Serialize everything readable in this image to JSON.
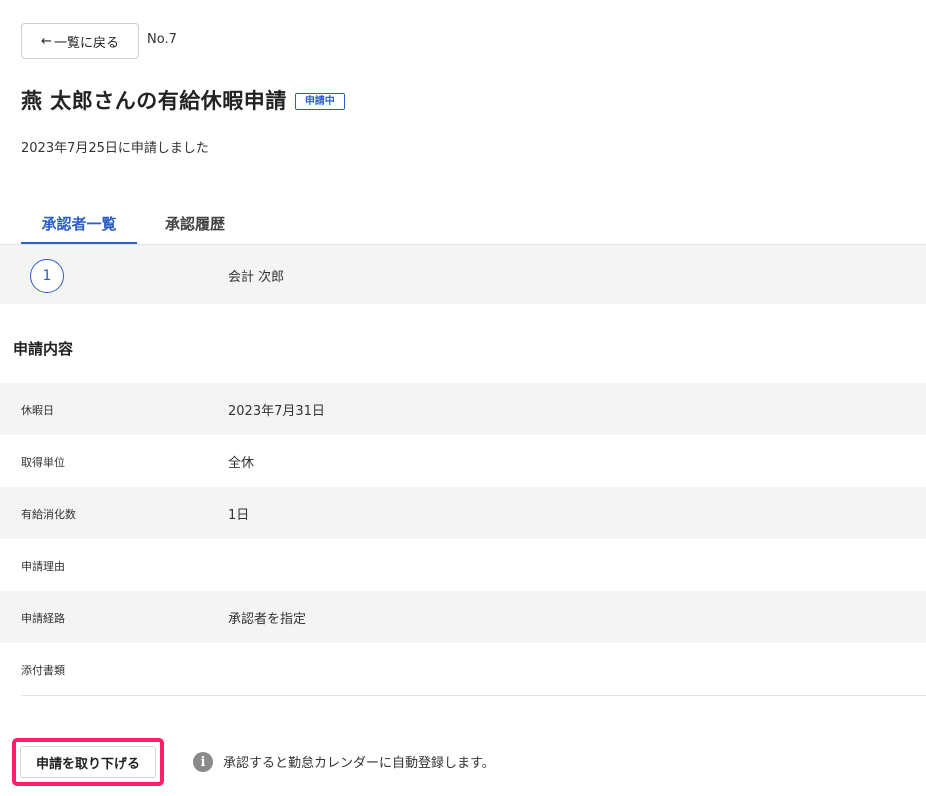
{
  "header": {
    "back_arrow": "←",
    "back_label": "一覧に戻る",
    "record_no": "No.7"
  },
  "title": {
    "text": "燕 太郎さんの有給休暇申請",
    "status": "申請中"
  },
  "applied_date": "2023年7月25日に申請しました",
  "tabs": [
    {
      "label": "承認者一覧",
      "active": true
    },
    {
      "label": "承認履歴",
      "active": false
    }
  ],
  "approvers": [
    {
      "step": "1",
      "name": "会計 次郎"
    }
  ],
  "details": {
    "section_title": "申請内容",
    "rows": [
      {
        "label": "休暇日",
        "value": "2023年7月31日"
      },
      {
        "label": "取得単位",
        "value": "全休"
      },
      {
        "label": "有給消化数",
        "value": "1日"
      },
      {
        "label": "申請理由",
        "value": ""
      },
      {
        "label": "申請経路",
        "value": "承認者を指定"
      },
      {
        "label": "添付書類",
        "value": ""
      }
    ]
  },
  "footer": {
    "withdraw_label": "申請を取り下げる",
    "info_icon": "i",
    "info_text": "承認すると勤怠カレンダーに自動登録します。"
  },
  "colors": {
    "accent": "#2d5fc4",
    "highlight": "#ff1f6b",
    "row_shade": "#f5f4f5"
  }
}
